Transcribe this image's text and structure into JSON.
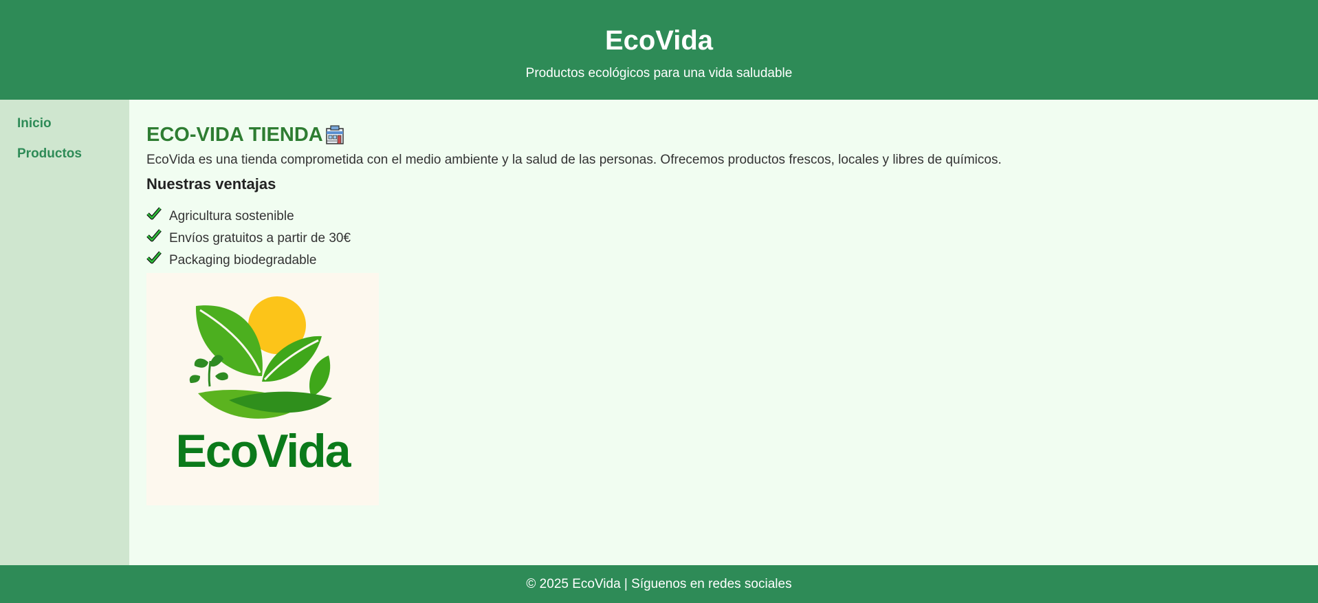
{
  "header": {
    "title": "EcoVida",
    "subtitle": "Productos ecológicos para una vida saludable"
  },
  "nav": {
    "items": [
      {
        "label": "Inicio"
      },
      {
        "label": "Productos"
      }
    ]
  },
  "main": {
    "heading": "ECO-VIDA TIENDA",
    "heading_icon": "store-icon",
    "intro": "EcoVida es una tienda comprometida con el medio ambiente y la salud de las personas. Ofrecemos productos frescos, locales y libres de químicos.",
    "subheading": "Nuestras ventajas",
    "advantages": [
      {
        "icon": "check-icon",
        "text": "Agricultura sostenible"
      },
      {
        "icon": "check-icon",
        "text": "Envíos gratuitos a partir de 30€"
      },
      {
        "icon": "check-icon",
        "text": "Packaging biodegradable"
      }
    ],
    "logo": {
      "text": "EcoVida"
    }
  },
  "footer": {
    "text": "© 2025 EcoVida | Síguenos en redes sociales"
  },
  "colors": {
    "brand_green": "#2e8b57",
    "sidebar_bg": "#cfe6cf",
    "main_bg": "#f1fdf1",
    "heading_green": "#2e7d32",
    "logo_green": "#0b7a1a",
    "sun_yellow": "#fcc419"
  }
}
